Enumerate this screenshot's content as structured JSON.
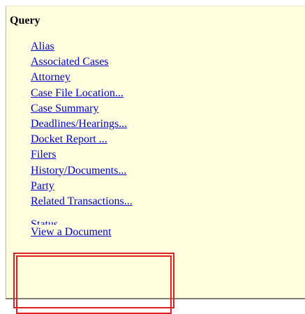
{
  "panel": {
    "title": "Query"
  },
  "menu": {
    "items": [
      {
        "label": "Alias"
      },
      {
        "label": "Associated Cases"
      },
      {
        "label": "Attorney"
      },
      {
        "label": "Case File Location..."
      },
      {
        "label": "Case Summary"
      },
      {
        "label": "Deadlines/Hearings..."
      },
      {
        "label": "Docket Report ..."
      },
      {
        "label": "Filers"
      },
      {
        "label": "History/Documents..."
      },
      {
        "label": "Party"
      },
      {
        "label": "Related Transactions..."
      },
      {
        "label": "Status"
      },
      {
        "label": "View a Document"
      }
    ]
  },
  "colors": {
    "panel_background": "#ffffe0",
    "link": "#0000cc",
    "highlight_border": "#e02020"
  }
}
